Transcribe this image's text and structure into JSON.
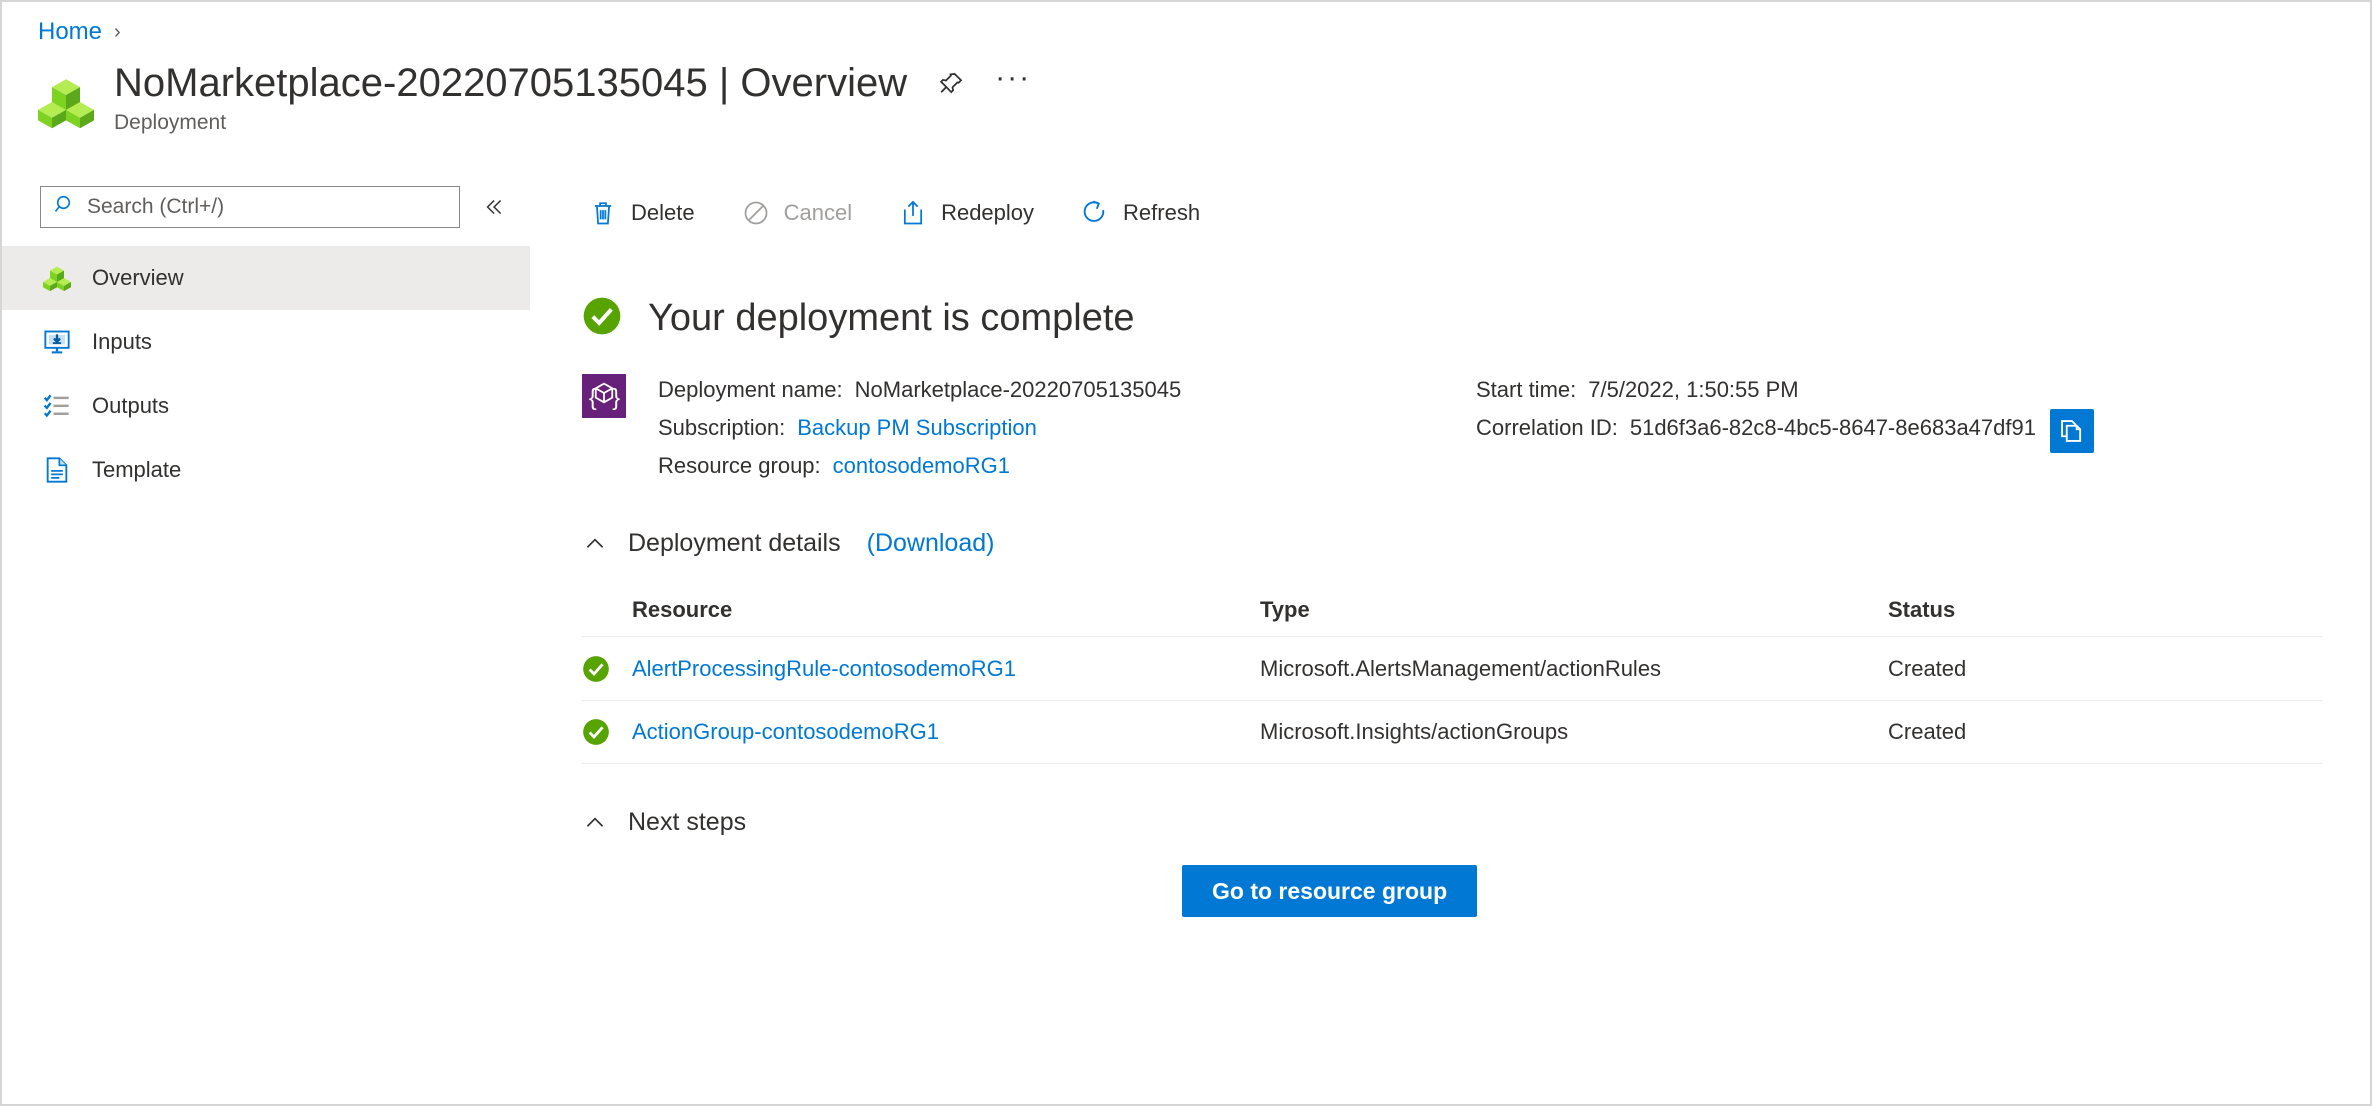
{
  "breadcrumb": {
    "home": "Home",
    "separator": "›"
  },
  "header": {
    "title": "NoMarketplace-20220705135045 | Overview",
    "subtitle": "Deployment",
    "pin_label": "Pin",
    "more_label": "···"
  },
  "sidebar": {
    "search_placeholder": "Search (Ctrl+/)",
    "search_value": "",
    "collapse_label": "«",
    "items": [
      {
        "label": "Overview",
        "icon": "cubes-icon",
        "selected": true
      },
      {
        "label": "Inputs",
        "icon": "inputs-icon",
        "selected": false
      },
      {
        "label": "Outputs",
        "icon": "outputs-icon",
        "selected": false
      },
      {
        "label": "Template",
        "icon": "template-icon",
        "selected": false
      }
    ]
  },
  "toolbar": {
    "delete_label": "Delete",
    "cancel_label": "Cancel",
    "redeploy_label": "Redeploy",
    "refresh_label": "Refresh"
  },
  "status": {
    "heading": "Your deployment is complete",
    "icon": "success-check-icon"
  },
  "info": {
    "deployment_name_label": "Deployment name:",
    "deployment_name_value": "NoMarketplace-20220705135045",
    "subscription_label": "Subscription:",
    "subscription_value": "Backup PM Subscription",
    "resource_group_label": "Resource group:",
    "resource_group_value": "contosodemoRG1",
    "start_time_label": "Start time:",
    "start_time_value": "7/5/2022, 1:50:55 PM",
    "correlation_id_label": "Correlation ID:",
    "correlation_id_value": "51d6f3a6-82c8-4bc5-8647-8e683a47df91",
    "copy_label": "Copy"
  },
  "deployment_details": {
    "title": "Deployment details",
    "download_label": "(Download)",
    "columns": {
      "resource": "Resource",
      "type": "Type",
      "status": "Status"
    },
    "rows": [
      {
        "resource": "AlertProcessingRule-contosodemoRG1",
        "type": "Microsoft.AlertsManagement/actionRules",
        "status": "Created"
      },
      {
        "resource": "ActionGroup-contosodemoRG1",
        "type": "Microsoft.Insights/actionGroups",
        "status": "Created"
      }
    ]
  },
  "next_steps": {
    "title": "Next steps",
    "button_label": "Go to resource group"
  },
  "colors": {
    "accent": "#0078d4",
    "success": "#57a300",
    "link": "#0078d4",
    "selected_bg": "#edebe9",
    "purple": "#68217a"
  }
}
